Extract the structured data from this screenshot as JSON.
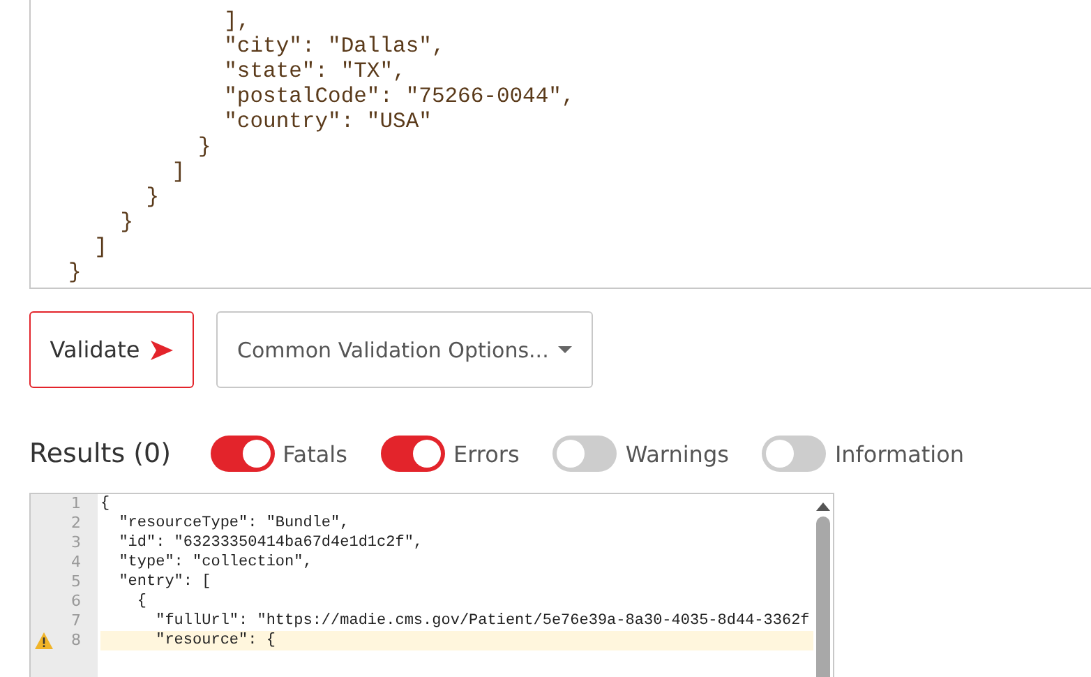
{
  "request_editor": {
    "lines": [
      "            ],",
      "            \"city\": \"Dallas\",",
      "            \"state\": \"TX\",",
      "            \"postalCode\": \"75266-0044\",",
      "            \"country\": \"USA\"",
      "          }",
      "        ]",
      "      }",
      "    }",
      "  ]",
      "}"
    ]
  },
  "validate_button": {
    "label": "Validate"
  },
  "options_dropdown": {
    "value": "Common Validation Options..."
  },
  "results": {
    "title": "Results (0)",
    "filters": [
      {
        "label": "Fatals",
        "on": true
      },
      {
        "label": "Errors",
        "on": true
      },
      {
        "label": "Warnings",
        "on": false
      },
      {
        "label": "Information",
        "on": false
      }
    ]
  },
  "result_editor": {
    "lines": [
      {
        "number": "1",
        "text": "{",
        "warning": false
      },
      {
        "number": "2",
        "text": "  \"resourceType\": \"Bundle\",",
        "warning": false
      },
      {
        "number": "3",
        "text": "  \"id\": \"63233350414ba67d4e1d1c2f\",",
        "warning": false
      },
      {
        "number": "4",
        "text": "  \"type\": \"collection\",",
        "warning": false
      },
      {
        "number": "5",
        "text": "  \"entry\": [",
        "warning": false
      },
      {
        "number": "6",
        "text": "    {",
        "warning": false
      },
      {
        "number": "7",
        "text": "      \"fullUrl\": \"https://madie.cms.gov/Patient/5e76e39a-8a30-4035-8d44-3362f",
        "warning": false
      },
      {
        "number": "8",
        "text": "      \"resource\": {",
        "warning": true
      }
    ]
  }
}
